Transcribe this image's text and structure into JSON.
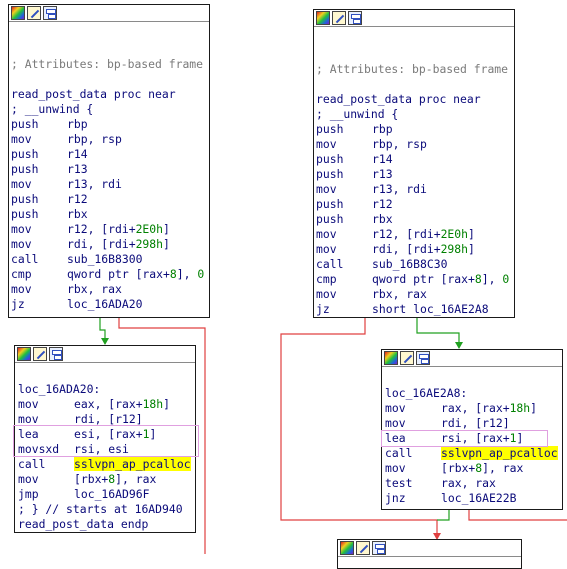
{
  "colors": {
    "mnemonic": "#0a0a7a",
    "comment": "#7a7a7a",
    "number": "#008000",
    "highlight": "#ffff00",
    "edge_red": "#e04040",
    "edge_green": "#20a020",
    "box": "#e0a0e0"
  },
  "icons": [
    "color-palette-icon",
    "edit-pencil-icon",
    "graph-view-icon"
  ],
  "left": {
    "top": {
      "attr": "; Attributes: bp-based frame",
      "proc": "read_post_data proc near",
      "unwind": "; __unwind {",
      "lines": [
        {
          "m": "push",
          "o": "rbp"
        },
        {
          "m": "mov",
          "o": "rbp, rsp"
        },
        {
          "m": "push",
          "o": "r14"
        },
        {
          "m": "push",
          "o": "r13"
        },
        {
          "m": "mov",
          "o": "r13, rdi"
        },
        {
          "m": "push",
          "o": "r12"
        },
        {
          "m": "push",
          "o": "rbx"
        },
        {
          "m": "mov",
          "o1": "r12, [rdi+",
          "n": "2E0h",
          "o2": "]"
        },
        {
          "m": "mov",
          "o1": "rdi, [rdi+",
          "n": "298h",
          "o2": "]"
        },
        {
          "m": "call",
          "o": "sub_16B8300"
        },
        {
          "m": "cmp",
          "o1": "qword ptr [rax+",
          "n": "8",
          "o2": "], ",
          "n2": "0"
        },
        {
          "m": "mov",
          "o": "rbx, rax"
        },
        {
          "m": "jz",
          "o": "loc_16ADA20"
        }
      ]
    },
    "bottom": {
      "label": "loc_16ADA20:",
      "lines": [
        {
          "m": "mov",
          "o1": "eax, [rax+",
          "n": "18h",
          "o2": "]"
        },
        {
          "m": "mov",
          "o": "rdi, [r12]"
        },
        {
          "m": "lea",
          "o1": "esi, [rax+",
          "n": "1",
          "o2": "]"
        },
        {
          "m": "movsxd",
          "o": "rsi, esi"
        },
        {
          "m": "call",
          "h": "sslvpn_ap_pcalloc"
        },
        {
          "m": "mov",
          "o1": "[rbx+",
          "n": "8",
          "o2": "], rax"
        },
        {
          "m": "jmp",
          "o": "loc_16AD96F"
        }
      ],
      "tail1": "; } // starts at 16AD940",
      "tail2": "read_post_data endp"
    }
  },
  "right": {
    "top": {
      "attr": "; Attributes: bp-based frame",
      "proc": "read_post_data proc near",
      "unwind": "; __unwind {",
      "lines": [
        {
          "m": "push",
          "o": "rbp"
        },
        {
          "m": "mov",
          "o": "rbp, rsp"
        },
        {
          "m": "push",
          "o": "r14"
        },
        {
          "m": "push",
          "o": "r13"
        },
        {
          "m": "mov",
          "o": "r13, rdi"
        },
        {
          "m": "push",
          "o": "r12"
        },
        {
          "m": "push",
          "o": "rbx"
        },
        {
          "m": "mov",
          "o1": "r12, [rdi+",
          "n": "2E0h",
          "o2": "]"
        },
        {
          "m": "mov",
          "o1": "rdi, [rdi+",
          "n": "298h",
          "o2": "]"
        },
        {
          "m": "call",
          "o": "sub_16B8C30"
        },
        {
          "m": "cmp",
          "o1": "qword ptr [rax+",
          "n": "8",
          "o2": "], ",
          "n2": "0"
        },
        {
          "m": "mov",
          "o": "rbx, rax"
        },
        {
          "m": "jz",
          "o": "short loc_16AE2A8"
        }
      ]
    },
    "bottom": {
      "label": "loc_16AE2A8:",
      "lines": [
        {
          "m": "mov",
          "o1": "rax, [rax+",
          "n": "18h",
          "o2": "]"
        },
        {
          "m": "mov",
          "o": "rdi, [r12]"
        },
        {
          "m": "lea",
          "o1": "rsi, [rax+",
          "n": "1",
          "o2": "]"
        },
        {
          "m": "call",
          "h": "sslvpn_ap_pcalloc"
        },
        {
          "m": "mov",
          "o1": "[rbx+",
          "n": "8",
          "o2": "], rax"
        },
        {
          "m": "test",
          "o": "rax, rax"
        },
        {
          "m": "jnz",
          "o": "loc_16AE22B"
        }
      ]
    }
  }
}
